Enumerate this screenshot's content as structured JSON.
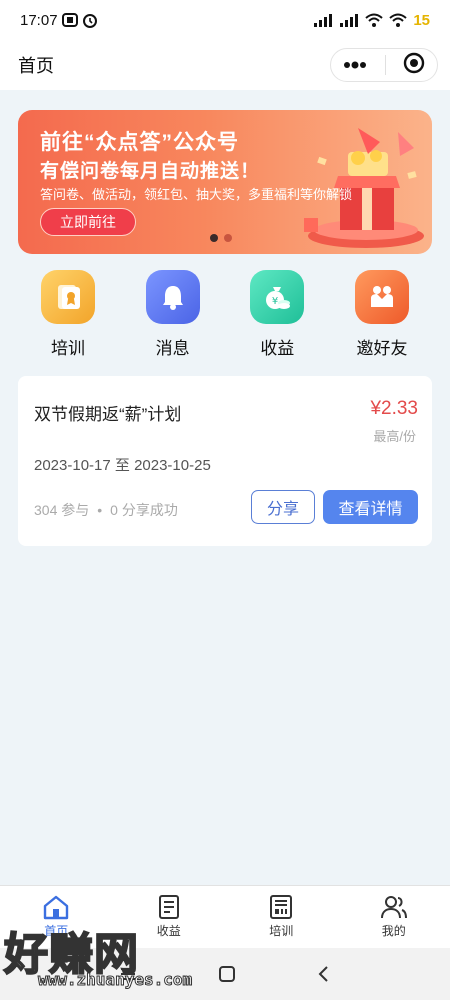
{
  "status_bar": {
    "time": "17:07",
    "battery": "15"
  },
  "navbar": {
    "title": "首页",
    "more_icon": "more-dots-icon",
    "close_icon": "target-circle-icon"
  },
  "banner": {
    "title_line1": "前往“众点答”公众号",
    "title_line2": "有偿问卷每月自动推送！",
    "subtitle": "答问卷、做活动，领红包、抽大奖，多重福利等你解锁",
    "button_label": "立即前往",
    "slide_count": 2,
    "active_slide": 1
  },
  "quick_actions": [
    {
      "label": "培训",
      "icon": "certificate-icon",
      "color": "#f5b53a"
    },
    {
      "label": "消息",
      "icon": "bell-icon",
      "color": "#5a76ef"
    },
    {
      "label": "收益",
      "icon": "money-bag-icon",
      "color": "#2fcfa9"
    },
    {
      "label": "邀好友",
      "icon": "handshake-icon",
      "color": "#f36b3a"
    }
  ],
  "campaign_card": {
    "title": "双节假期返“薪”计划",
    "price": "¥2.33",
    "price_note": "最高/份",
    "dates": "2023-10-17 至 2023-10-25",
    "participants": "304 参与",
    "separator": "•",
    "shares": "0 分享成功",
    "share_button": "分享",
    "detail_button": "查看详情"
  },
  "tabbar": {
    "tabs": [
      {
        "label": "首页",
        "icon": "home-icon",
        "active": true
      },
      {
        "label": "收益",
        "icon": "document-icon",
        "active": false
      },
      {
        "label": "培训",
        "icon": "training-book-icon",
        "active": false
      },
      {
        "label": "我的",
        "icon": "users-icon",
        "active": false
      }
    ]
  },
  "watermark": {
    "text": "好赚网",
    "url": "www.zhuanyes.com"
  },
  "colors": {
    "accent": "#5585ee",
    "price": "#e34b4b",
    "banner_start": "#f46a4e",
    "banner_end": "#fbb38a"
  }
}
